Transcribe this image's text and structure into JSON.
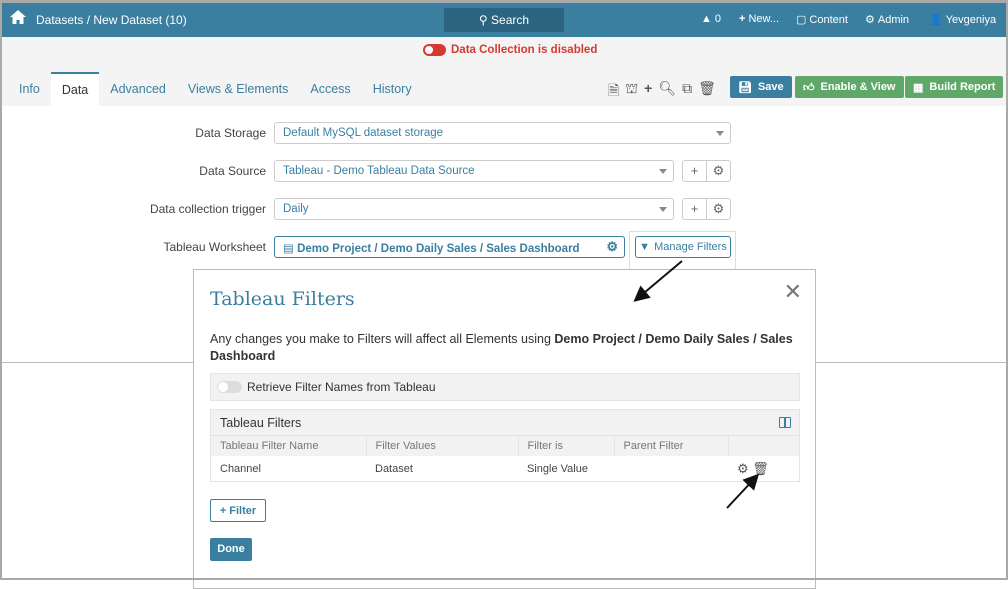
{
  "header": {
    "breadcrumb": "Datasets / New Dataset (10)",
    "search_label": "Search",
    "alerts_count": "0",
    "new_label": "New...",
    "content_label": "Content",
    "admin_label": "Admin",
    "user_name": "Yevgeniya"
  },
  "status": {
    "data_collection": "Data Collection is disabled",
    "color": "#d43a2f"
  },
  "tabs": [
    {
      "label": "Info"
    },
    {
      "label": "Data"
    },
    {
      "label": "Advanced"
    },
    {
      "label": "Views & Elements"
    },
    {
      "label": "Access"
    },
    {
      "label": "History"
    }
  ],
  "buttons": {
    "save": "Save",
    "enable_view": "Enable & View",
    "build_report": "Build Report"
  },
  "form": {
    "data_storage": {
      "label": "Data Storage",
      "value": "Default MySQL dataset storage"
    },
    "data_source": {
      "label": "Data Source",
      "value": "Tableau - Demo Tableau Data Source"
    },
    "trigger": {
      "label": "Data collection trigger",
      "value": "Daily"
    },
    "worksheet": {
      "label": "Tableau Worksheet",
      "value": "Demo Project / Demo Daily Sales / Sales Dashboard"
    },
    "manage_filters": "Manage Filters"
  },
  "modal": {
    "title": "Tableau Filters",
    "notice": "Any changes you make to Filters will affect all Elements using ",
    "notice_bold": "Demo Project / Demo Daily Sales / Sales Dashboard",
    "retrieve_label": "Retrieve Filter Names from Tableau",
    "panel_title": "Tableau Filters",
    "columns": [
      "Tableau Filter Name",
      "Filter Values",
      "Filter is",
      "Parent Filter"
    ],
    "rows": [
      {
        "name": "Channel",
        "values": "Dataset",
        "filter_is": "Single Value",
        "parent": ""
      }
    ],
    "add_filter": "Filter",
    "done": "Done"
  },
  "colors": {
    "brand": "#3a7fa0",
    "green": "#5fa86a"
  }
}
